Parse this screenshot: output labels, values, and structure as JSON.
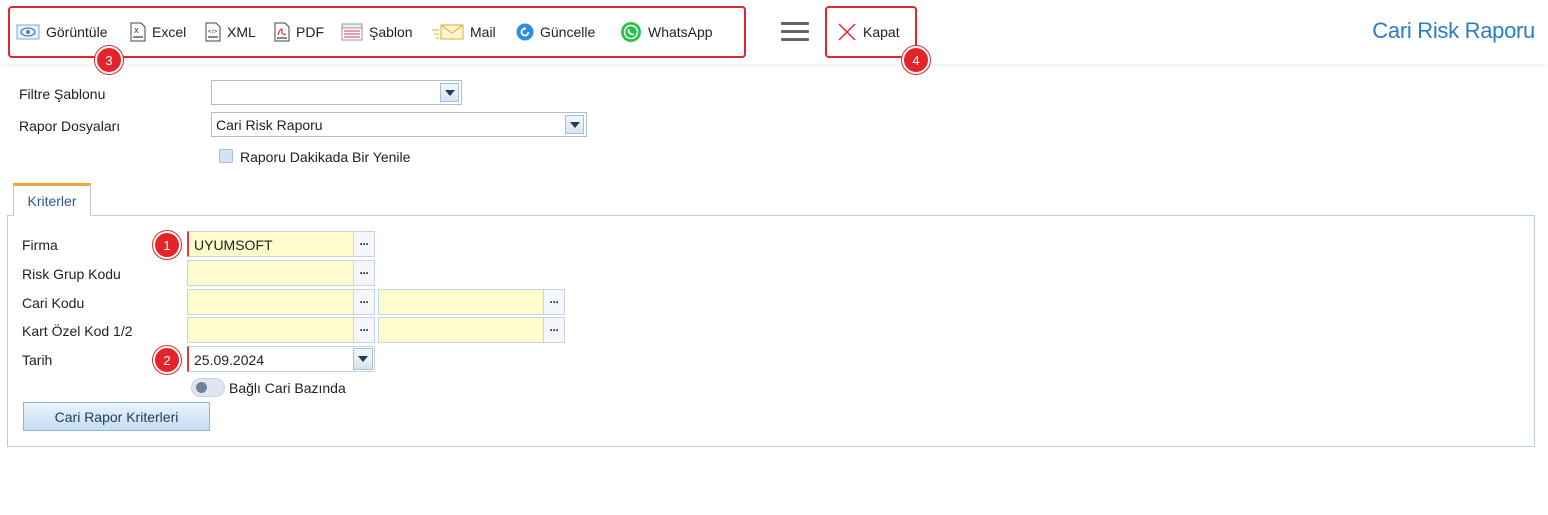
{
  "toolbar": {
    "items": [
      {
        "label": "Görüntüle",
        "icon": "eye-icon"
      },
      {
        "label": "Excel",
        "icon": "excel-icon"
      },
      {
        "label": "XML",
        "icon": "xml-icon"
      },
      {
        "label": "PDF",
        "icon": "pdf-icon"
      },
      {
        "label": "Şablon",
        "icon": "template-icon"
      },
      {
        "label": "Mail",
        "icon": "mail-icon"
      },
      {
        "label": "Güncelle",
        "icon": "refresh-icon"
      },
      {
        "label": "WhatsApp",
        "icon": "whatsapp-icon"
      }
    ],
    "close_label": "Kapat",
    "report_title": "Cari Risk Raporu"
  },
  "badges": [
    "1",
    "2",
    "3",
    "4"
  ],
  "top_form": {
    "filter_template_label": "Filtre Şablonu",
    "filter_template_value": "",
    "report_files_label": "Rapor Dosyaları",
    "report_files_value": "Cari Risk Raporu",
    "refresh_checkbox_label": "Raporu Dakikada Bir Yenile",
    "refresh_checked": false
  },
  "tabs": [
    {
      "label": "Kriterler"
    }
  ],
  "criteria": {
    "firma_label": "Firma",
    "firma_value": "UYUMSOFT",
    "risk_group_label": "Risk Grup Kodu",
    "risk_group_value": "",
    "cari_kodu_label": "Cari Kodu",
    "cari_kodu_from": "",
    "cari_kodu_to": "",
    "kart_ozel_label": "Kart Özel Kod 1/2",
    "kart_ozel_1": "",
    "kart_ozel_2": "",
    "tarih_label": "Tarih",
    "tarih_value": "25.09.2024",
    "bagli_cari_label": "Bağlı Cari Bazında",
    "bagli_cari_on": false,
    "button_label": "Cari Rapor Kriterleri"
  },
  "colors": {
    "accent": "#2a7cc7",
    "highlight_border": "#e3242b",
    "field_bg": "#fdfccc",
    "tab_top": "#f3a33a"
  }
}
